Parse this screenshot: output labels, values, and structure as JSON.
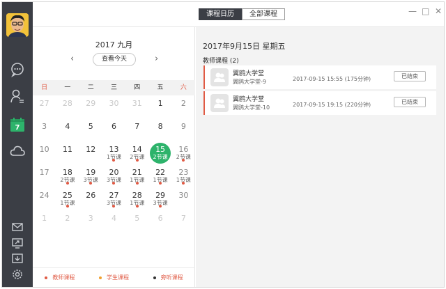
{
  "window": {
    "tabs": [
      {
        "label": "课程日历",
        "active": true
      },
      {
        "label": "全部课程",
        "active": false
      }
    ],
    "controls": [
      "—",
      "□",
      "✕"
    ]
  },
  "sidebar": {
    "items": [
      {
        "icon": "chat-icon",
        "active": false
      },
      {
        "icon": "contacts-icon",
        "active": false
      },
      {
        "icon": "calendar-icon",
        "active": true,
        "label": "7"
      },
      {
        "icon": "cloud-icon",
        "active": false
      }
    ],
    "bottom_items": [
      {
        "icon": "mail-icon"
      },
      {
        "icon": "screen-share-icon"
      },
      {
        "icon": "export-icon"
      },
      {
        "icon": "settings-icon"
      }
    ],
    "colors": {
      "background": "#3b3e45",
      "active": "#2db36b"
    }
  },
  "calendar": {
    "title": "2017 九月",
    "prev": "‹",
    "next": "›",
    "today_button": "查看今天",
    "weekdays": [
      "日",
      "一",
      "二",
      "三",
      "四",
      "五",
      "六"
    ],
    "weeks": [
      [
        {
          "day": "27",
          "other": true
        },
        {
          "day": "28",
          "other": true
        },
        {
          "day": "29",
          "other": true
        },
        {
          "day": "30",
          "other": true
        },
        {
          "day": "31",
          "other": true
        },
        {
          "day": "1"
        },
        {
          "day": "2",
          "weekend": true
        }
      ],
      [
        {
          "day": "3",
          "weekend": true
        },
        {
          "day": "4"
        },
        {
          "day": "5"
        },
        {
          "day": "6"
        },
        {
          "day": "7"
        },
        {
          "day": "8"
        },
        {
          "day": "9",
          "weekend": true
        }
      ],
      [
        {
          "day": "10",
          "weekend": true
        },
        {
          "day": "11"
        },
        {
          "day": "12"
        },
        {
          "day": "13",
          "lessons": "1节课",
          "dot": true
        },
        {
          "day": "14",
          "lessons": "2节课",
          "dot": true
        },
        {
          "day": "15",
          "lessons": "2节课",
          "today": true
        },
        {
          "day": "16",
          "lessons": "2节课",
          "dot": true,
          "weekend": true
        }
      ],
      [
        {
          "day": "17",
          "weekend": true
        },
        {
          "day": "18",
          "lessons": "2节课",
          "dot": true
        },
        {
          "day": "19",
          "lessons": "3节课",
          "dot": true
        },
        {
          "day": "20",
          "lessons": "3节课",
          "dot": true
        },
        {
          "day": "21",
          "lessons": "1节课",
          "dot": true
        },
        {
          "day": "22",
          "lessons": "1节课",
          "dot": true
        },
        {
          "day": "23",
          "lessons": "1节课",
          "dot": true,
          "weekend": true
        }
      ],
      [
        {
          "day": "24",
          "weekend": true
        },
        {
          "day": "25",
          "lessons": "1节课",
          "dot": true
        },
        {
          "day": "26"
        },
        {
          "day": "27",
          "lessons": "3节课",
          "dot": true
        },
        {
          "day": "28",
          "lessons": "1节课",
          "dot": true
        },
        {
          "day": "29",
          "lessons": "3节课",
          "dot": true
        },
        {
          "day": "30",
          "weekend": true
        }
      ],
      [
        {
          "day": "1",
          "other": true
        },
        {
          "day": "2",
          "other": true
        },
        {
          "day": "3",
          "other": true
        },
        {
          "day": "4",
          "other": true
        },
        {
          "day": "5",
          "other": true
        },
        {
          "day": "6",
          "other": true
        },
        {
          "day": "7",
          "other": true
        }
      ]
    ],
    "legend": [
      {
        "label": "教师课程",
        "color": "#e05a44"
      },
      {
        "label": "学生课程",
        "color": "#f0a030"
      },
      {
        "label": "旁听课程",
        "color": "#333333"
      }
    ],
    "colors": {
      "weekend_header": "#e05a44",
      "today": "#2db36b",
      "dot": "#e05a44"
    }
  },
  "detail": {
    "date_header": "2017年9月15日   星期五",
    "section_label": "教师课程 (2)",
    "courses": [
      {
        "name": "翼鸥大学堂",
        "subtitle": "翼鸥大学堂-9",
        "time": "2017-09-15 15:55 (175分钟)",
        "status_button": "已结束"
      },
      {
        "name": "翼鸥大学堂",
        "subtitle": "翼鸥大学堂-10",
        "time": "2017-09-15 19:15 (220分钟)",
        "status_button": "已结束"
      }
    ]
  }
}
